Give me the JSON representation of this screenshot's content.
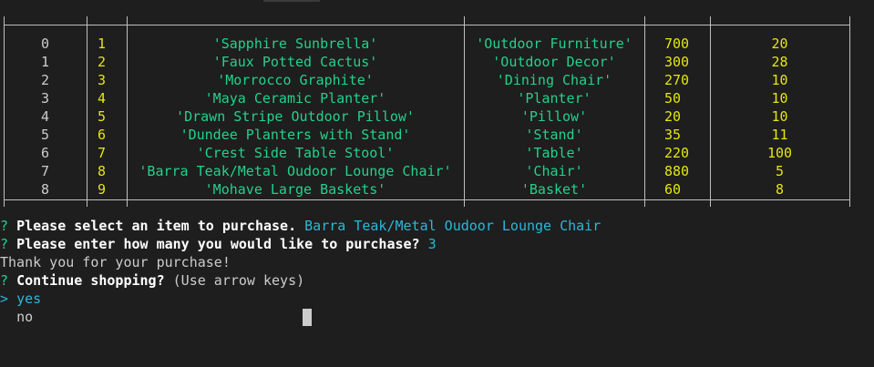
{
  "table": {
    "rows": [
      {
        "idx": "0",
        "id": "1",
        "name": "'Sapphire Sunbrella'",
        "dept": "'Outdoor Furniture'",
        "price": "700",
        "qty": "20"
      },
      {
        "idx": "1",
        "id": "2",
        "name": "'Faux Potted Cactus'",
        "dept": "'Outdoor Decor'",
        "price": "300",
        "qty": "28"
      },
      {
        "idx": "2",
        "id": "3",
        "name": "'Morrocco Graphite'",
        "dept": "'Dining Chair'",
        "price": "270",
        "qty": "10"
      },
      {
        "idx": "3",
        "id": "4",
        "name": "'Maya Ceramic Planter'",
        "dept": "'Planter'",
        "price": "50",
        "qty": "10"
      },
      {
        "idx": "4",
        "id": "5",
        "name": "'Drawn Stripe Outdoor Pillow'",
        "dept": "'Pillow'",
        "price": "20",
        "qty": "10"
      },
      {
        "idx": "5",
        "id": "6",
        "name": "'Dundee Planters with Stand'",
        "dept": "'Stand'",
        "price": "35",
        "qty": "11"
      },
      {
        "idx": "6",
        "id": "7",
        "name": "'Crest Side Table Stool'",
        "dept": "'Table'",
        "price": "220",
        "qty": "100"
      },
      {
        "idx": "7",
        "id": "8",
        "name": "'Barra Teak/Metal Oudoor Lounge Chair'",
        "dept": "'Chair'",
        "price": "880",
        "qty": "5"
      },
      {
        "idx": "8",
        "id": "9",
        "name": "'Mohave Large Baskets'",
        "dept": "'Basket'",
        "price": "60",
        "qty": "8"
      }
    ]
  },
  "prompts": {
    "select_mark": "?",
    "select_label": "Please select an item to purchase.",
    "select_answer": "Barra Teak/Metal Oudoor Lounge Chair",
    "qty_mark": "?",
    "qty_label": "Please enter how many you would like to purchase?",
    "qty_answer": "3",
    "thanks": "Thank you for your purchase!",
    "continue_mark": "?",
    "continue_label": "Continue shopping?",
    "continue_hint": "(Use arrow keys)",
    "pointer": ">",
    "option_yes": "yes",
    "option_no": "no"
  }
}
